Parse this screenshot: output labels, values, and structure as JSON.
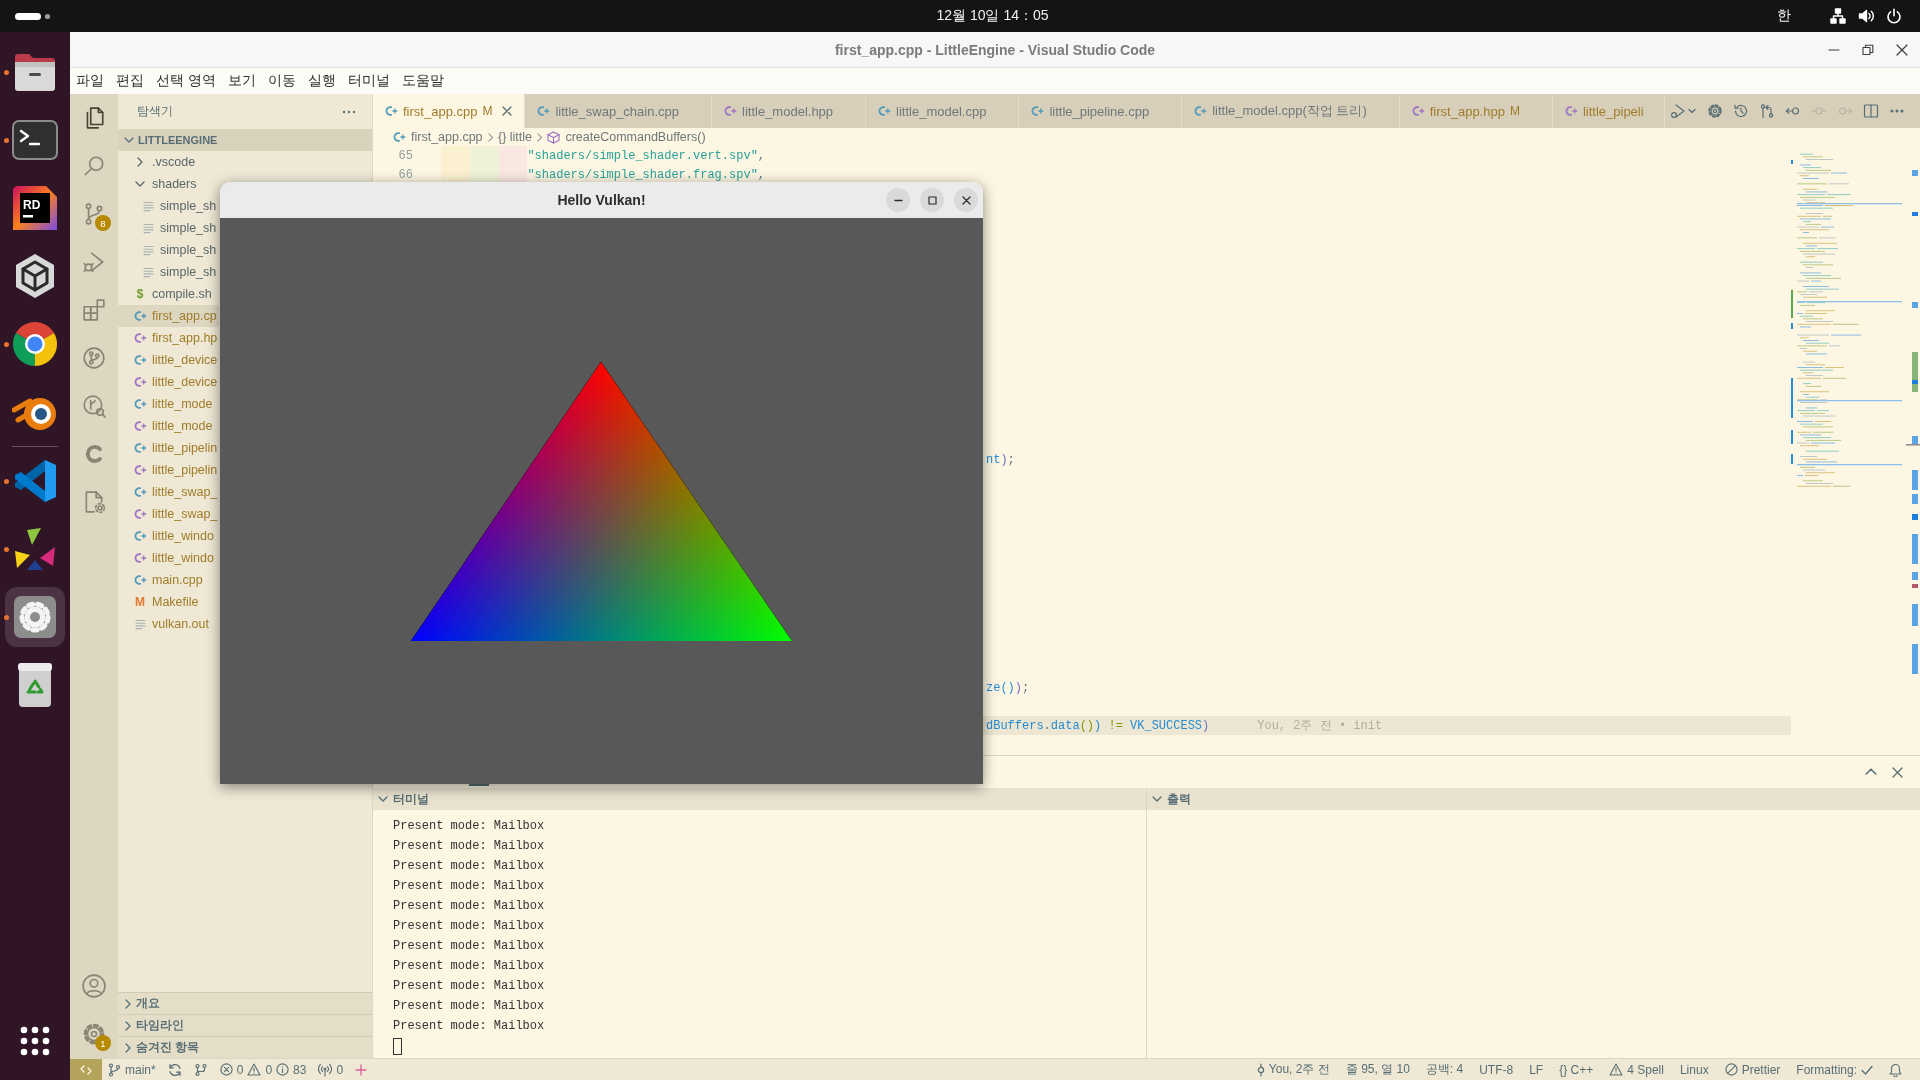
{
  "top_bar": {
    "clock": "12월 10일 14：05",
    "input_method": "한",
    "indicators": [
      {
        "kind": "network"
      },
      {
        "kind": "volume"
      },
      {
        "kind": "power"
      }
    ]
  },
  "dock": {
    "favorites": [
      {
        "kind": "files",
        "running": true,
        "selected": false
      },
      {
        "kind": "terminal",
        "running": true,
        "selected": false
      },
      {
        "kind": "rider",
        "label": "RD",
        "running": false,
        "selected": false
      },
      {
        "kind": "unity",
        "running": false,
        "selected": false
      },
      {
        "kind": "chrome",
        "running": true,
        "selected": false
      },
      {
        "kind": "blender",
        "running": false,
        "selected": false
      }
    ],
    "open_apps": [
      {
        "kind": "vscode",
        "running": true,
        "selected": false
      },
      {
        "kind": "triangles",
        "running": true,
        "selected": false
      },
      {
        "kind": "gear",
        "running": true,
        "selected": true
      },
      {
        "kind": "trash",
        "running": false,
        "selected": false
      }
    ]
  },
  "vscode": {
    "title": "first_app.cpp - LittleEngine - Visual Studio Code",
    "window_controls": [
      {
        "kind": "minimize"
      },
      {
        "kind": "restore"
      },
      {
        "kind": "close"
      }
    ],
    "menu": [
      "파일",
      "편집",
      "선택 영역",
      "보기",
      "이동",
      "실행",
      "터미널",
      "도움말"
    ],
    "activity_bar": {
      "top": [
        {
          "kind": "explorer",
          "selected": true
        },
        {
          "kind": "search",
          "selected": false
        },
        {
          "kind": "source-control",
          "selected": false,
          "badge": "8"
        },
        {
          "kind": "run-debug",
          "selected": false
        },
        {
          "kind": "extensions",
          "selected": false
        },
        {
          "kind": "git-graph",
          "selected": false
        },
        {
          "kind": "git-search",
          "selected": false
        },
        {
          "kind": "c-logo",
          "selected": false
        },
        {
          "kind": "cpp-settings",
          "selected": false
        }
      ],
      "bottom": [
        {
          "kind": "account"
        },
        {
          "kind": "manage",
          "badge": "1"
        }
      ]
    },
    "sidebar": {
      "title": "탐색기",
      "root": {
        "label": "LITTLEENGINE",
        "expanded": true
      },
      "tree": [
        {
          "name": ".vscode",
          "kind": "folder",
          "expanded": false,
          "modified": false,
          "selected": false
        },
        {
          "name": "shaders",
          "kind": "folder",
          "expanded": true,
          "modified": false,
          "selected": false,
          "children": [
            {
              "name": "simple_sh",
              "kind": "text",
              "modified": false,
              "selected": false
            },
            {
              "name": "simple_sh",
              "kind": "text",
              "modified": false,
              "selected": false
            },
            {
              "name": "simple_sh",
              "kind": "text",
              "modified": false,
              "selected": false
            },
            {
              "name": "simple_sh",
              "kind": "text",
              "modified": false,
              "selected": false
            }
          ]
        },
        {
          "name": "compile.sh",
          "kind": "shell",
          "glyph": "$",
          "modified": false,
          "selected": false
        },
        {
          "name": "first_app.cp",
          "kind": "source",
          "modified": true,
          "selected": true
        },
        {
          "name": "first_app.hp",
          "kind": "header",
          "modified": true,
          "selected": false
        },
        {
          "name": "little_device",
          "kind": "source",
          "modified": true,
          "selected": false
        },
        {
          "name": "little_device",
          "kind": "header",
          "modified": true,
          "selected": false
        },
        {
          "name": "little_mode",
          "kind": "source",
          "modified": true,
          "selected": false
        },
        {
          "name": "little_mode",
          "kind": "header",
          "modified": true,
          "selected": false
        },
        {
          "name": "little_pipelin",
          "kind": "source",
          "modified": true,
          "selected": false
        },
        {
          "name": "little_pipelin",
          "kind": "header",
          "modified": true,
          "selected": false
        },
        {
          "name": "little_swap_",
          "kind": "source",
          "modified": true,
          "selected": false
        },
        {
          "name": "little_swap_",
          "kind": "header",
          "modified": true,
          "selected": false
        },
        {
          "name": "little_windo",
          "kind": "source",
          "modified": true,
          "selected": false
        },
        {
          "name": "little_windo",
          "kind": "header",
          "modified": true,
          "selected": false
        },
        {
          "name": "main.cpp",
          "kind": "source",
          "modified": true,
          "selected": false
        },
        {
          "name": "Makefile",
          "kind": "make",
          "glyph": "M",
          "modified": true,
          "selected": false
        },
        {
          "name": "vulkan.out",
          "kind": "text",
          "modified": true,
          "selected": false
        }
      ],
      "sections": [
        {
          "label": "개요",
          "expanded": false
        },
        {
          "label": "타임라인",
          "expanded": false
        },
        {
          "label": "숨겨진 항목",
          "expanded": false
        }
      ]
    },
    "tabs": [
      {
        "label": "first_app.cpp",
        "kind": "source",
        "selected": true,
        "modified": true,
        "decoration": "M"
      },
      {
        "label": "little_swap_chain.cpp",
        "kind": "source",
        "selected": false,
        "modified": false
      },
      {
        "label": "little_model.hpp",
        "kind": "header",
        "selected": false,
        "modified": false
      },
      {
        "label": "little_model.cpp",
        "kind": "source",
        "selected": false,
        "modified": false
      },
      {
        "label": "little_pipeline.cpp",
        "kind": "source",
        "selected": false,
        "modified": false
      },
      {
        "label": "little_model.cpp(작업 트리)",
        "kind": "source",
        "selected": false,
        "modified": false
      },
      {
        "label": "first_app.hpp",
        "kind": "header",
        "selected": false,
        "modified": true,
        "decoration": "M"
      },
      {
        "label": "little_pipeli",
        "kind": "header",
        "selected": false,
        "modified": true
      }
    ],
    "editor_actions": [
      {
        "kind": "run-debug",
        "disabled": false
      },
      {
        "kind": "dropdown",
        "disabled": false
      },
      {
        "kind": "gear",
        "disabled": false
      },
      {
        "kind": "history",
        "disabled": false
      },
      {
        "kind": "compare",
        "disabled": false
      },
      {
        "kind": "back",
        "disabled": false
      },
      {
        "kind": "previous",
        "disabled": true
      },
      {
        "kind": "forward",
        "disabled": true
      },
      {
        "kind": "split",
        "disabled": false
      },
      {
        "kind": "more",
        "disabled": false
      }
    ],
    "breadcrumb": [
      {
        "kind": "file",
        "label": "first_app.cpp"
      },
      {
        "kind": "namespace",
        "glyph": "{}",
        "label": "little"
      },
      {
        "kind": "method",
        "label": "createCommandBuffers()"
      }
    ],
    "code_lines": [
      {
        "number": "65",
        "current": false,
        "tokens": [
          {
            "kind": "string",
            "text": "\"shaders/simple_shader.vert.spv\""
          },
          {
            "kind": "punct",
            "text": ","
          }
        ]
      },
      {
        "number": "66",
        "current": false,
        "tokens": [
          {
            "kind": "string",
            "text": "\"shaders/simple_shader.frag.spv\""
          },
          {
            "kind": "punct",
            "text": ","
          }
        ]
      },
      {
        "current": false,
        "tokens": [
          {
            "kind": "ident",
            "text": "nt"
          },
          {
            "kind": "bracket1",
            "text": ")"
          },
          {
            "kind": "punct",
            "text": ";"
          }
        ]
      },
      {
        "current": false,
        "tokens": [
          {
            "kind": "ident",
            "text": "ze"
          },
          {
            "kind": "bracket2",
            "text": "()"
          },
          {
            "kind": "bracket1",
            "text": ")"
          },
          {
            "kind": "punct",
            "text": ";"
          }
        ]
      },
      {
        "current": true,
        "tokens": [
          {
            "kind": "ident",
            "text": "dBuffers"
          },
          {
            "kind": "punct",
            "text": "."
          },
          {
            "kind": "ident",
            "text": "data"
          },
          {
            "kind": "bracket3",
            "text": "()"
          },
          {
            "kind": "bracket2",
            "text": ")"
          },
          {
            "kind": "operator",
            "text": " != "
          },
          {
            "kind": "constant",
            "text": "VK_SUCCESS"
          },
          {
            "kind": "bracket1",
            "text": ")"
          }
        ],
        "blame": "You, 2주 전 • init"
      }
    ],
    "panel": {
      "actions": [
        {
          "kind": "maximize"
        },
        {
          "kind": "close"
        }
      ],
      "terminal": {
        "title": "터미널",
        "expanded": true,
        "lines": [
          "Present mode: Mailbox",
          "Present mode: Mailbox",
          "Present mode: Mailbox",
          "Present mode: Mailbox",
          "Present mode: Mailbox",
          "Present mode: Mailbox",
          "Present mode: Mailbox",
          "Present mode: Mailbox",
          "Present mode: Mailbox",
          "Present mode: Mailbox",
          "Present mode: Mailbox"
        ],
        "cursor": true
      },
      "output": {
        "title": "출력",
        "expanded": true
      }
    },
    "status_bar": {
      "left": [
        {
          "kind": "remote"
        },
        {
          "kind": "branch",
          "text": "main*"
        },
        {
          "kind": "sync"
        },
        {
          "kind": "graph"
        },
        {
          "kind": "problems",
          "errors": "0",
          "warnings": "0",
          "infos": "83"
        },
        {
          "kind": "ports",
          "text": "0"
        },
        {
          "kind": "add"
        }
      ],
      "right": [
        {
          "kind": "blame",
          "text": "You, 2주 전"
        },
        {
          "kind": "text",
          "text": "줄 95, 열 10"
        },
        {
          "kind": "text",
          "text": "공백: 4"
        },
        {
          "kind": "text",
          "text": "UTF-8"
        },
        {
          "kind": "text",
          "text": "LF"
        },
        {
          "kind": "language",
          "glyph": "{}",
          "text": "C++"
        },
        {
          "kind": "spell",
          "text": "4 Spell"
        },
        {
          "kind": "text",
          "text": "Linux"
        },
        {
          "kind": "prettier",
          "text": "Prettier"
        },
        {
          "kind": "formatting",
          "text": "Formatting:"
        },
        {
          "kind": "bell"
        }
      ]
    }
  },
  "popup_window": {
    "title": "Hello Vulkan!",
    "controls": [
      {
        "kind": "minimize"
      },
      {
        "kind": "maximize"
      },
      {
        "kind": "close"
      }
    ]
  }
}
